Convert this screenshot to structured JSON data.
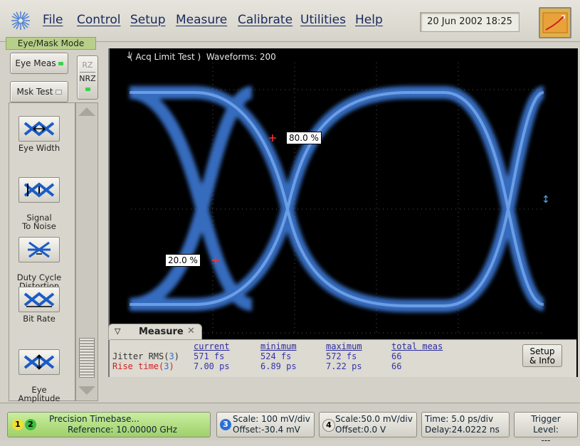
{
  "menu": {
    "items": [
      "File",
      "Control",
      "Setup",
      "Measure",
      "Calibrate",
      "Utilities",
      "Help"
    ],
    "datetime": "20 Jun 2002  18:25"
  },
  "left": {
    "mode_label": "Eye/Mask Mode",
    "eye_meas": "Eye Meas",
    "msk_test": "Msk Test",
    "rz": "RZ",
    "nrz": "NRZ",
    "tools": [
      "Eye Width",
      "Signal\nTo Noise",
      "Duty Cycle\nDistortion",
      "Bit Rate",
      "Eye\nAmplitude"
    ]
  },
  "screen": {
    "status": "( Acq Limit Test )  Waveforms: 200",
    "marker_high": "80.0 %",
    "marker_low": "20.0 %",
    "trigger_marker": "↕"
  },
  "measure": {
    "tab_label": "Measure",
    "headers": [
      "current",
      "minimum",
      "maximum",
      "total meas"
    ],
    "rows": [
      {
        "name": "Jitter RMS(",
        "chan": "3",
        "close": ")",
        "values": [
          "571 fs",
          "524 fs",
          "572 fs",
          "66"
        ]
      },
      {
        "name": "Rise time(",
        "chan": "3",
        "close": ")",
        "values": [
          "7.00 ps",
          "6.89 ps",
          "7.22 ps",
          "66"
        ]
      }
    ],
    "setup_btn": "Setup\n& Info"
  },
  "bottom": {
    "ch1": "1",
    "ch2": "2",
    "timebase_line1": "Precision Timebase...",
    "timebase_line2": "Reference: 10.00000 GHz",
    "ch3": "3",
    "ch3_scale": "Scale: 100 mV/div",
    "ch3_offset": "Offset:-30.4 mV",
    "ch4": "4",
    "ch4_scale": "Scale:50.0 mV/div",
    "ch4_offset": "Offset:0.0 V",
    "time": "Time: 5.0 ps/div",
    "delay": "Delay:24.0222 ns",
    "trigger_label": "Trigger Level:",
    "trigger_value": "---"
  },
  "colors": {
    "eye_trace": "#3f7fe0",
    "screen_bg": "#000000",
    "menu_text": "#1a2a60",
    "mode_green": "#b8cf8a",
    "timebase_green": "#b6e08a"
  }
}
